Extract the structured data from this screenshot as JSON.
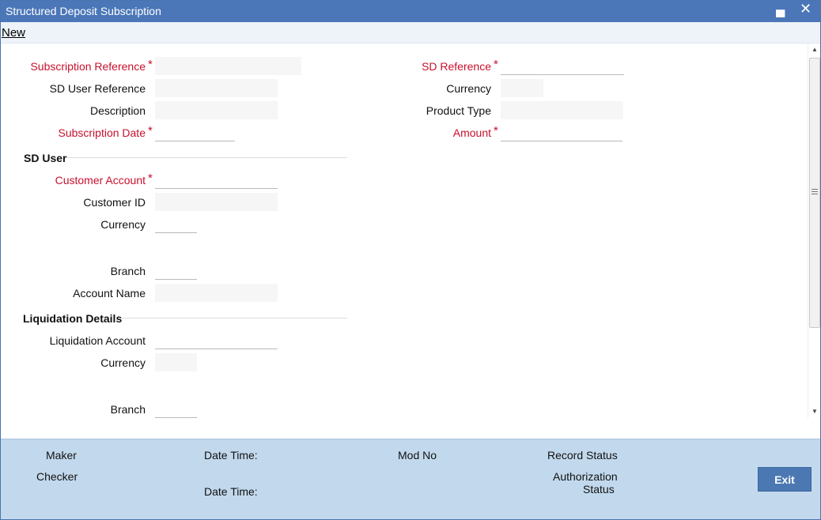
{
  "window": {
    "title": "Structured Deposit Subscription",
    "minimize_glyph": "▄",
    "close_glyph": "✕"
  },
  "toolbar": {
    "new_label": "New"
  },
  "form": {
    "subscription_reference": {
      "label": "Subscription Reference",
      "value": "",
      "required": true
    },
    "sd_user_reference": {
      "label": "SD User Reference",
      "value": ""
    },
    "description": {
      "label": "Description",
      "value": ""
    },
    "subscription_date": {
      "label": "Subscription Date",
      "value": "",
      "required": true
    },
    "sd_reference": {
      "label": "SD Reference",
      "value": "",
      "required": true
    },
    "currency": {
      "label": "Currency",
      "value": ""
    },
    "product_type": {
      "label": "Product Type",
      "value": ""
    },
    "amount": {
      "label": "Amount",
      "value": "",
      "required": true
    },
    "required_marker": "*"
  },
  "sd_user": {
    "heading": "SD User",
    "customer_account": {
      "label": "Customer Account",
      "value": "",
      "required": true
    },
    "customer_id": {
      "label": "Customer ID",
      "value": ""
    },
    "currency": {
      "label": "Currency",
      "value": ""
    },
    "branch": {
      "label": "Branch",
      "value": ""
    },
    "account_name": {
      "label": "Account Name",
      "value": ""
    }
  },
  "liquidation": {
    "heading": "Liquidation Details",
    "liquidation_account": {
      "label": "Liquidation Account",
      "value": ""
    },
    "currency": {
      "label": "Currency",
      "value": ""
    },
    "branch": {
      "label": "Branch",
      "value": ""
    }
  },
  "footer": {
    "maker": "Maker",
    "checker": "Checker",
    "date_time_1": "Date Time:",
    "date_time_2": "Date Time:",
    "mod_no": "Mod No",
    "record_status": "Record Status",
    "authorization_status_line1": "Authorization",
    "authorization_status_line2": "Status",
    "exit_label": "Exit"
  },
  "colors": {
    "titlebar": "#4b77b8",
    "required_label": "#c8102e",
    "footer_bg": "#c2d9ed",
    "exit_button": "#4b78b2"
  },
  "icons": [
    "minimize-icon",
    "close-icon",
    "scroll-up-icon",
    "scroll-down-icon"
  ]
}
